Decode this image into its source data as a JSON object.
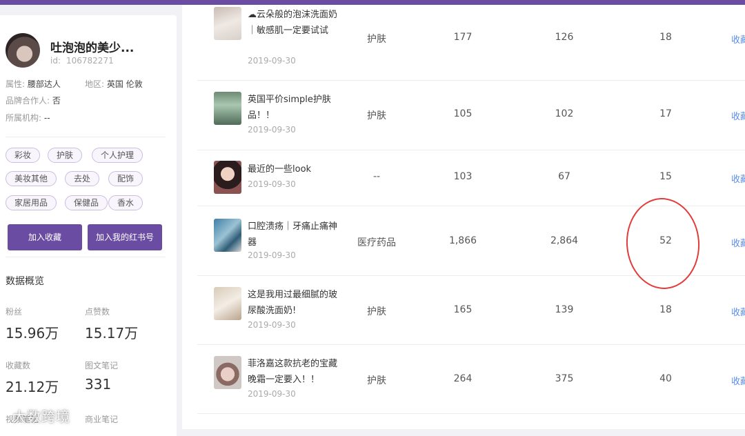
{
  "profile": {
    "name": "吐泡泡的美少...",
    "id_label": "id:",
    "id_value": "106782271",
    "attr_label": "属性:",
    "attr_value": "腰部达人",
    "region_label": "地区:",
    "region_value": "英国 伦敦",
    "brand_label": "品牌合作人:",
    "brand_value": "否",
    "org_label": "所属机构:",
    "org_value": "--"
  },
  "tags": [
    "彩妆",
    "护肤",
    "个人护理",
    "美妆其他",
    "去处",
    "配饰",
    "家居用品",
    "保健品",
    "香水"
  ],
  "buttons": {
    "favorite": "加入收藏",
    "add_redbook": "加入我的红书号"
  },
  "overview": {
    "title": "数据概览",
    "fans_label": "粉丝",
    "fans_value": "15.96万",
    "likes_label": "点赞数",
    "likes_value": "15.17万",
    "collects_label": "收藏数",
    "collects_value": "21.12万",
    "notes_label": "图文笔记",
    "notes_value": "331",
    "partial_left": "视频笔记",
    "partial_right": "商业笔记"
  },
  "watermark": "大数跨境",
  "notes": [
    {
      "title": "☁云朵般的泡沫洗面奶｜敏感肌一定要试试",
      "date": "2019-09-30",
      "category": "护肤",
      "a": "177",
      "b": "126",
      "c": "18",
      "action": "收藏"
    },
    {
      "title": "英国平价simple护肤品！！",
      "date": "2019-09-30",
      "category": "护肤",
      "a": "105",
      "b": "102",
      "c": "17",
      "action": "收藏"
    },
    {
      "title": "最近的一些look",
      "date": "2019-09-30",
      "category": "--",
      "a": "103",
      "b": "67",
      "c": "15",
      "action": "收藏"
    },
    {
      "title": "口腔溃疡｜牙痛止痛神器",
      "date": "2019-09-30",
      "category": "医疗药品",
      "a": "1,866",
      "b": "2,864",
      "c": "52",
      "action": "收藏"
    },
    {
      "title": "这是我用过最细腻的玻尿酸洗面奶!",
      "date": "2019-09-30",
      "category": "护肤",
      "a": "165",
      "b": "139",
      "c": "18",
      "action": "收藏"
    },
    {
      "title": "菲洛嘉这款抗老的宝藏晚霜一定要入！！",
      "date": "2019-09-30",
      "category": "护肤",
      "a": "264",
      "b": "375",
      "c": "40",
      "action": "收藏"
    }
  ],
  "colors": {
    "brand": "#6a4da2",
    "link": "#5a8de3",
    "annotation": "#e23b3b"
  }
}
